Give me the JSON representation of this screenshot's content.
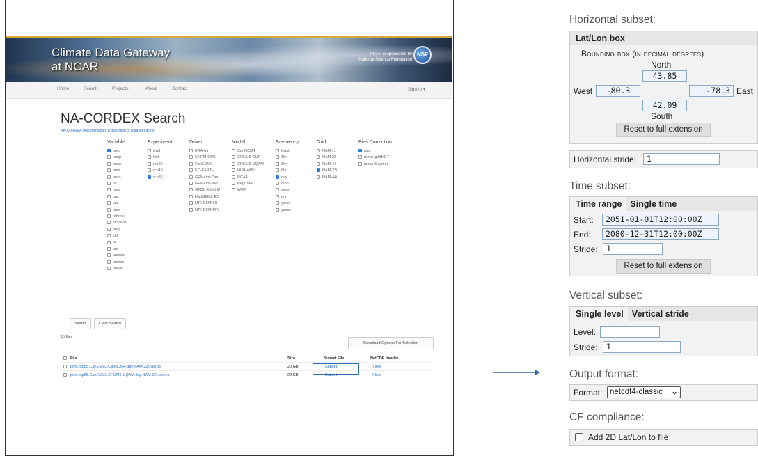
{
  "left": {
    "banner": {
      "title_line1": "Climate Data Gateway",
      "title_line2": "at NCAR",
      "sponsor_line1": "NCAR is sponsored by",
      "sponsor_line2": "National Science Foundation",
      "logo_text": "NSF"
    },
    "nav": {
      "home": "Home",
      "search": "Search",
      "projects": "Projects",
      "about": "About",
      "contact": "Contact",
      "sign_in": "Sign In ▾"
    },
    "title": "NA-CORDEX Search",
    "doc_link": "NA-CORDEX Documentation: Explanation of Dataset Facets",
    "facets": [
      {
        "header": "Variable",
        "options": [
          {
            "label": "prec",
            "checked": true
          },
          {
            "label": "temp"
          },
          {
            "label": "tmax"
          },
          {
            "label": "tmin"
          },
          {
            "label": "huss"
          },
          {
            "label": "ps"
          },
          {
            "label": "rsds"
          },
          {
            "label": "uas"
          },
          {
            "label": "vas"
          },
          {
            "label": "hurs"
          },
          {
            "label": "prhmax"
          },
          {
            "label": "sfcWind"
          },
          {
            "label": "orog"
          },
          {
            "label": "sftlf"
          },
          {
            "label": "pr"
          },
          {
            "label": "tas"
          },
          {
            "label": "tasmax"
          },
          {
            "label": "tasmin"
          },
          {
            "label": "tmean"
          }
        ]
      },
      {
        "header": "Experiment",
        "options": [
          {
            "label": "eval"
          },
          {
            "label": "hist"
          },
          {
            "label": "rcp26"
          },
          {
            "label": "rcp45"
          },
          {
            "label": "rcp85",
            "checked": true
          }
        ]
      },
      {
        "header": "Driver",
        "options": [
          {
            "label": "ERA-Int"
          },
          {
            "label": "CNRM-CM5"
          },
          {
            "label": "CanESM2"
          },
          {
            "label": "EC-EARTH"
          },
          {
            "label": "GEMatm-Can"
          },
          {
            "label": "GEMatm-MPI"
          },
          {
            "label": "GFDL-ESM2M"
          },
          {
            "label": "HadGEM2-ES"
          },
          {
            "label": "MPI-ESM-LR"
          },
          {
            "label": "MPI-ESM-MR"
          }
        ]
      },
      {
        "header": "Model",
        "options": [
          {
            "label": "CanRCM4"
          },
          {
            "label": "CRCM5-OUR"
          },
          {
            "label": "CRCM5-UQAM"
          },
          {
            "label": "HIRHAM5"
          },
          {
            "label": "RCA4"
          },
          {
            "label": "RegCM4"
          },
          {
            "label": "WRF"
          }
        ]
      },
      {
        "header": "Frequency",
        "options": [
          {
            "label": "fixed"
          },
          {
            "label": "1hr"
          },
          {
            "label": "3hr"
          },
          {
            "label": "6hr"
          },
          {
            "label": "day",
            "checked": true
          },
          {
            "label": "mon"
          },
          {
            "label": "seas"
          },
          {
            "label": "ann"
          },
          {
            "label": "ymon"
          },
          {
            "label": "yseas"
          }
        ]
      },
      {
        "header": "Grid",
        "options": [
          {
            "label": "NAM-11"
          },
          {
            "label": "NAM-22"
          },
          {
            "label": "NAM-44"
          },
          {
            "label": "NAM-22i",
            "checked": true
          },
          {
            "label": "NAM-44i"
          }
        ]
      },
      {
        "header": "Bias Correction",
        "options": [
          {
            "label": "raw",
            "checked": true
          },
          {
            "label": "mbcn-gridMET"
          },
          {
            "label": "mbcn-Daymet"
          }
        ]
      }
    ],
    "buttons": {
      "search": "Search",
      "clear": "Clear Search",
      "download": "Download Options For Selection"
    },
    "files_count": "16 files",
    "table": {
      "headers": {
        "file": "File",
        "size": "Size",
        "subset": "Subset File",
        "header": "NetCDF Header"
      },
      "rows": [
        {
          "file": "prec.rcp85.CanESM2.CanRCM4.day.NAM-22i.raw.nc",
          "size": "20 GB",
          "subset": "Subset",
          "header": "View"
        },
        {
          "file": "prec.rcp85.CanESM2.CRCM5-UQAM.day.NAM-22i.raw.nc",
          "size": "20 GB",
          "subset": "Subset",
          "header": "View"
        }
      ]
    }
  },
  "right": {
    "horizontal": {
      "title": "Horizontal subset:",
      "tab": "Lat/Lon box",
      "bbox_title": "Bounding box (in decimal degrees)",
      "north_label": "North",
      "south_label": "South",
      "west_label": "West",
      "east_label": "East",
      "north": "43.85",
      "south": "42.09",
      "west": "-80.3",
      "east": "-78.3",
      "reset": "Reset to full extension",
      "stride_label": "Horizontal stride:",
      "stride": "1"
    },
    "time": {
      "title": "Time subset:",
      "tab_range": "Time range",
      "tab_single": "Single time",
      "start_label": "Start:",
      "start": "2051-01-01T12:00:00Z",
      "end_label": "End:",
      "end": "2080-12-31T12:00:00Z",
      "stride_label": "Stride:",
      "stride": "1",
      "reset": "Reset to full extension"
    },
    "vertical": {
      "title": "Vertical subset:",
      "tab_single": "Single level",
      "tab_stride": "Vertical stride",
      "level_label": "Level:",
      "level": "",
      "stride_label": "Stride:",
      "stride": "1"
    },
    "output": {
      "title": "Output format:",
      "label": "Format:",
      "value": "netcdf4-classic"
    },
    "cf": {
      "title": "CF compliance:",
      "checkbox_label": "Add 2D Lat/Lon to file",
      "checked": false
    }
  }
}
